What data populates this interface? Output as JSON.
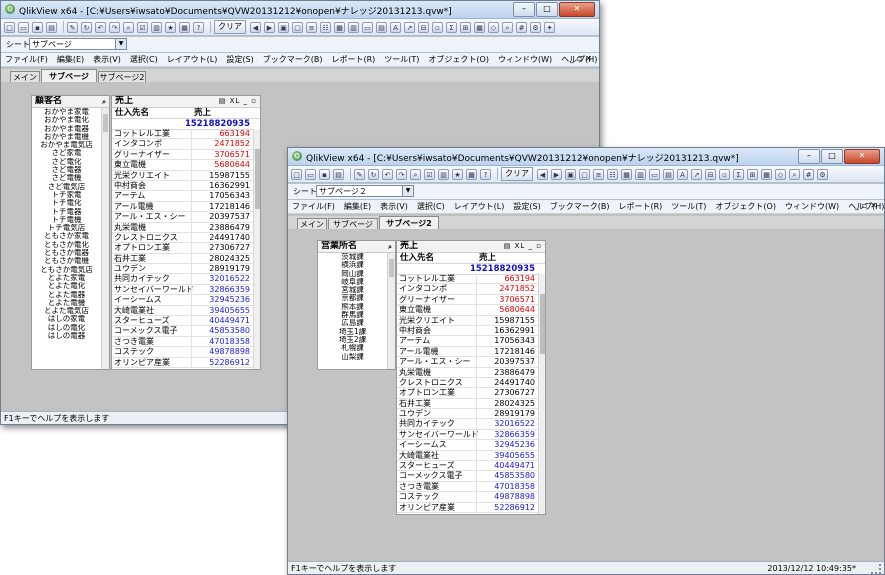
{
  "colors": {
    "red": "#e00000",
    "blue": "#1a1ae0",
    "black": "#000000"
  },
  "window_back": {
    "title": "QlikView x64 - [C:¥Users¥iwsato¥Documents¥QVW20131212¥onopen¥ナレッジ20131213.qvw*]",
    "sheet_label": "シート",
    "sheet_value": "サブページ",
    "clear_label": "クリア",
    "menu": [
      "ファイル(F)",
      "編集(E)",
      "表示(V)",
      "選択(C)",
      "レイアウト(L)",
      "設定(S)",
      "ブックマーク(B)",
      "レポート(R)",
      "ツール(T)",
      "オブジェクト(O)",
      "ウィンドウ(W)",
      "ヘルプ(H)"
    ],
    "tabs": [
      "メイン",
      "サブページ",
      "サブページ2"
    ],
    "listbox": {
      "title": "顧客名",
      "items": [
        "おかやま家電",
        "おかやま電化",
        "おかやま電器",
        "おかやま電機",
        "おかやま電気店",
        "さど家電",
        "さど電化",
        "さど電器",
        "さど電機",
        "さど電気店",
        "トチ家電",
        "トチ電化",
        "トチ電器",
        "トチ電機",
        "トチ電気店",
        "ともさか家電",
        "ともさか電化",
        "ともさか電器",
        "ともさか電機",
        "ともさか電気店",
        "とよた家電",
        "とよた電化",
        "とよた電器",
        "とよた電機",
        "とよた電気店",
        "はしの家電",
        "はしの電化",
        "はしの電器"
      ]
    },
    "status": "F1キーでヘルプを表示します"
  },
  "window_front": {
    "title": "QlikView x64 - [C:¥Users¥iwsato¥Documents¥QVW20131212¥onopen¥ナレッジ20131213.qvw*]",
    "sheet_label": "シート",
    "sheet_value": "サブページ２",
    "clear_label": "クリア",
    "menu": [
      "ファイル(F)",
      "編集(E)",
      "表示(V)",
      "選択(C)",
      "レイアウト(L)",
      "設定(S)",
      "ブックマーク(B)",
      "レポート(R)",
      "ツール(T)",
      "オブジェクト(O)",
      "ウィンドウ(W)",
      "ヘルプ(H)"
    ],
    "tabs": [
      "メイン",
      "サブページ",
      "サブページ2"
    ],
    "listbox": {
      "title": "営業所名",
      "items": [
        "茨城課",
        "横浜課",
        "岡山課",
        "岐阜課",
        "宮城課",
        "京都課",
        "熊本課",
        "群馬課",
        "広島課",
        "埼玉1課",
        "埼玉2課",
        "札幌課",
        "山梨課"
      ]
    },
    "status": "F1キーでヘルプを表示します",
    "timestamp": "2013/12/12 10:49:35*"
  },
  "chart": {
    "title": "売上",
    "col1": "仕入先名",
    "col2": "売上",
    "total": "15218820935",
    "rows": [
      {
        "name": "コットレル工業",
        "value": "663194",
        "color": "red"
      },
      {
        "name": "インタコンポ",
        "value": "2471852",
        "color": "red"
      },
      {
        "name": "グリーナイザー",
        "value": "3706571",
        "color": "red"
      },
      {
        "name": "東立電機",
        "value": "5680644",
        "color": "red"
      },
      {
        "name": "光栄クリエイト",
        "value": "15987155",
        "color": "black"
      },
      {
        "name": "中村商会",
        "value": "16362991",
        "color": "black"
      },
      {
        "name": "アーテム",
        "value": "17056343",
        "color": "black"
      },
      {
        "name": "アール電機",
        "value": "17218146",
        "color": "black"
      },
      {
        "name": "アール・エス・シー",
        "value": "20397537",
        "color": "black"
      },
      {
        "name": "丸栄電機",
        "value": "23886479",
        "color": "black"
      },
      {
        "name": "クレストロニクス",
        "value": "24491740",
        "color": "black"
      },
      {
        "name": "オプトロン工業",
        "value": "27306727",
        "color": "black"
      },
      {
        "name": "石井工業",
        "value": "28024325",
        "color": "black"
      },
      {
        "name": "ユウデン",
        "value": "28919179",
        "color": "black"
      },
      {
        "name": "共同カイテック",
        "value": "32016522",
        "color": "blue"
      },
      {
        "name": "サンセイバーワールド",
        "value": "32866359",
        "color": "blue"
      },
      {
        "name": "イーシームス",
        "value": "32945236",
        "color": "blue"
      },
      {
        "name": "大崎電業社",
        "value": "39405655",
        "color": "blue"
      },
      {
        "name": "スターヒューズ",
        "value": "40449471",
        "color": "blue"
      },
      {
        "name": "コーメックス電子",
        "value": "45853580",
        "color": "blue"
      },
      {
        "name": "さつき電業",
        "value": "47018358",
        "color": "blue"
      },
      {
        "name": "コステック",
        "value": "49878898",
        "color": "blue"
      },
      {
        "name": "オリンピア産業",
        "value": "52286912",
        "color": "blue"
      }
    ]
  }
}
